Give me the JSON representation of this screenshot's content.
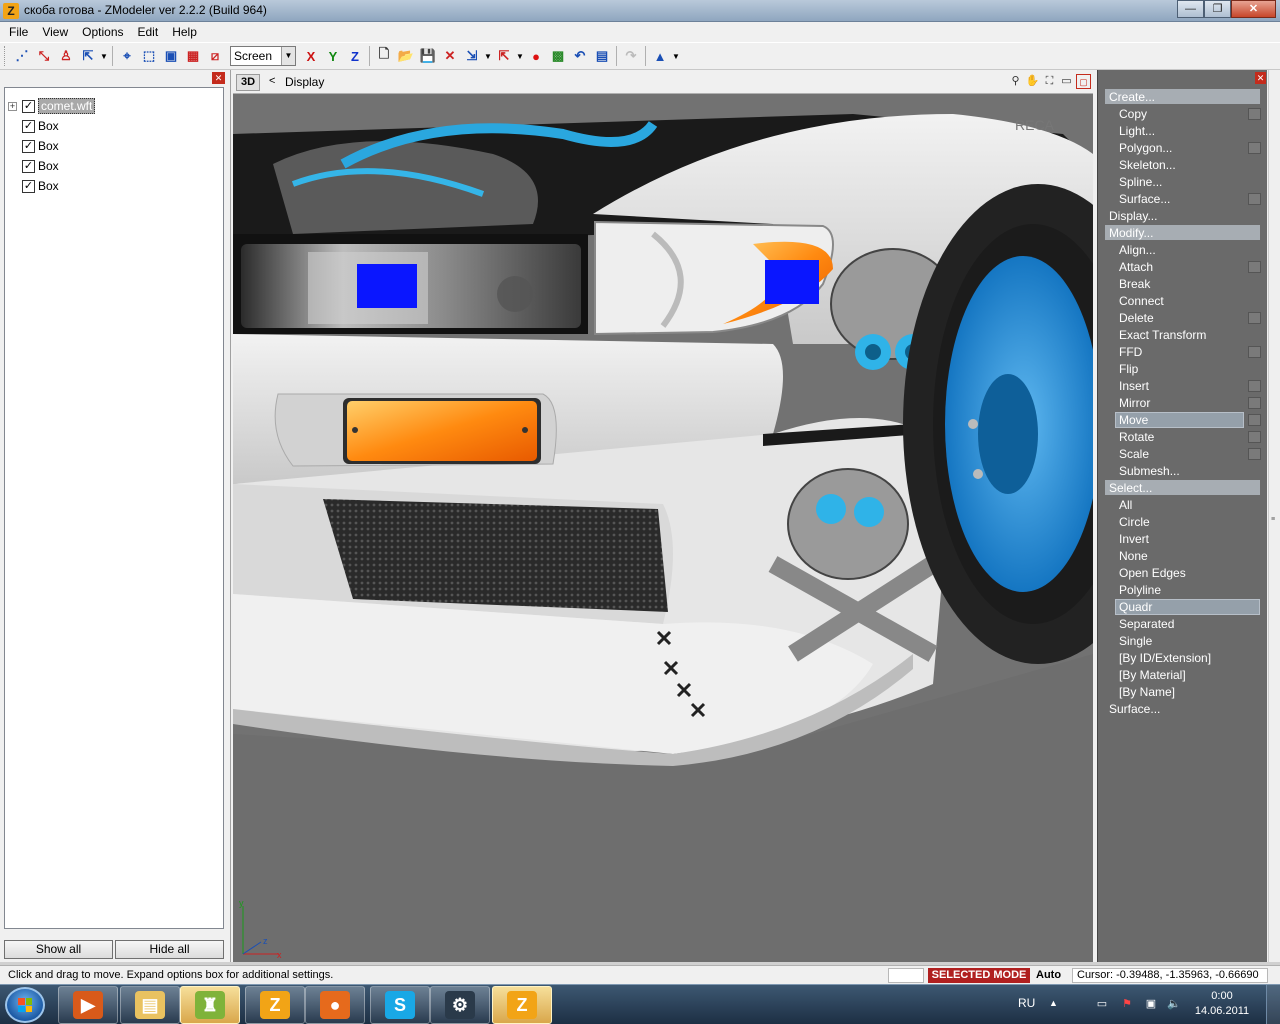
{
  "window": {
    "title": "скоба готова - ZModeler ver 2.2.2 (Build 964)",
    "app_icon_letter": "Z",
    "minimize": "—",
    "maximize": "❐",
    "close": "✕"
  },
  "menu": [
    "File",
    "View",
    "Options",
    "Edit",
    "Help"
  ],
  "toolbar": {
    "view_select": "Screen",
    "axes": [
      {
        "label": "X",
        "color": "#cc1111"
      },
      {
        "label": "Y",
        "color": "#118811"
      },
      {
        "label": "Z",
        "color": "#1133cc"
      }
    ]
  },
  "scene_tree": {
    "expander": "+",
    "root": {
      "label": "comet.wft",
      "checked": true
    },
    "children": [
      {
        "label": "Box",
        "checked": true
      },
      {
        "label": "Box",
        "checked": true
      },
      {
        "label": "Box",
        "checked": true
      },
      {
        "label": "Box",
        "checked": true
      }
    ],
    "show_all": "Show all",
    "hide_all": "Hide all"
  },
  "viewport": {
    "mode": "3D",
    "arrow": "<",
    "breadcrumb": "Display",
    "axis_labels": {
      "y": "y",
      "z": "z",
      "x": "x"
    },
    "decal_text": "RECA"
  },
  "command_panel": [
    {
      "label": "Create...",
      "kind": "header"
    },
    {
      "label": "Copy",
      "kind": "item",
      "box": true
    },
    {
      "label": "Light...",
      "kind": "item"
    },
    {
      "label": "Polygon...",
      "kind": "item",
      "box": true
    },
    {
      "label": "Skeleton...",
      "kind": "item"
    },
    {
      "label": "Spline...",
      "kind": "item"
    },
    {
      "label": "Surface...",
      "kind": "item",
      "box": true
    },
    {
      "label": "Display...",
      "kind": "top"
    },
    {
      "label": "Modify...",
      "kind": "header"
    },
    {
      "label": "Align...",
      "kind": "item"
    },
    {
      "label": "Attach",
      "kind": "item",
      "box": true
    },
    {
      "label": "Break",
      "kind": "item"
    },
    {
      "label": "Connect",
      "kind": "item"
    },
    {
      "label": "Delete",
      "kind": "item",
      "box": true
    },
    {
      "label": "Exact Transform",
      "kind": "item"
    },
    {
      "label": "FFD",
      "kind": "item",
      "box": true
    },
    {
      "label": "Flip",
      "kind": "item"
    },
    {
      "label": "Insert",
      "kind": "item",
      "box": true
    },
    {
      "label": "Mirror",
      "kind": "item",
      "box": true
    },
    {
      "label": "Move",
      "kind": "item",
      "box": true,
      "selected": true
    },
    {
      "label": "Rotate",
      "kind": "item",
      "box": true
    },
    {
      "label": "Scale",
      "kind": "item",
      "box": true
    },
    {
      "label": "Submesh...",
      "kind": "item"
    },
    {
      "label": "Select...",
      "kind": "header"
    },
    {
      "label": "All",
      "kind": "item"
    },
    {
      "label": "Circle",
      "kind": "item"
    },
    {
      "label": "Invert",
      "kind": "item"
    },
    {
      "label": "None",
      "kind": "item"
    },
    {
      "label": "Open Edges",
      "kind": "item"
    },
    {
      "label": "Polyline",
      "kind": "item"
    },
    {
      "label": "Quadr",
      "kind": "item",
      "selected": true
    },
    {
      "label": "Separated",
      "kind": "item"
    },
    {
      "label": "Single",
      "kind": "item"
    },
    {
      "label": "[By ID/Extension]",
      "kind": "item"
    },
    {
      "label": "[By Material]",
      "kind": "item"
    },
    {
      "label": "[By Name]",
      "kind": "item"
    },
    {
      "label": "Surface...",
      "kind": "top"
    }
  ],
  "status": {
    "hint": "Click and drag to move. Expand options box for additional settings.",
    "mode": "SELECTED MODE",
    "auto": "Auto",
    "cursor": "Cursor: -0.39488, -1.35963, -0.66690"
  },
  "taskbar": {
    "apps": [
      {
        "name": "media-player-icon",
        "glyph": "▶",
        "bg": "#d85a1a",
        "active": false
      },
      {
        "name": "explorer-icon",
        "glyph": "▤",
        "bg": "#e9c260",
        "active": false
      },
      {
        "name": "robot-app-icon",
        "glyph": "♜",
        "bg": "#7fb33a",
        "active": true
      },
      {
        "name": "zmodeler-icon",
        "glyph": "Z",
        "bg": "#f2a416",
        "active": false
      },
      {
        "name": "firefox-icon",
        "glyph": "●",
        "bg": "#e66a1c",
        "active": false
      },
      {
        "name": "skype-icon",
        "glyph": "S",
        "bg": "#19a8e6",
        "active": false
      },
      {
        "name": "steam-icon",
        "glyph": "⚙",
        "bg": "#2a3a4a",
        "active": false
      },
      {
        "name": "zmodeler-icon",
        "glyph": "Z",
        "bg": "#f2a416",
        "active": true
      }
    ],
    "lang": "RU",
    "time": "0:00",
    "date": "14.06.2011"
  }
}
